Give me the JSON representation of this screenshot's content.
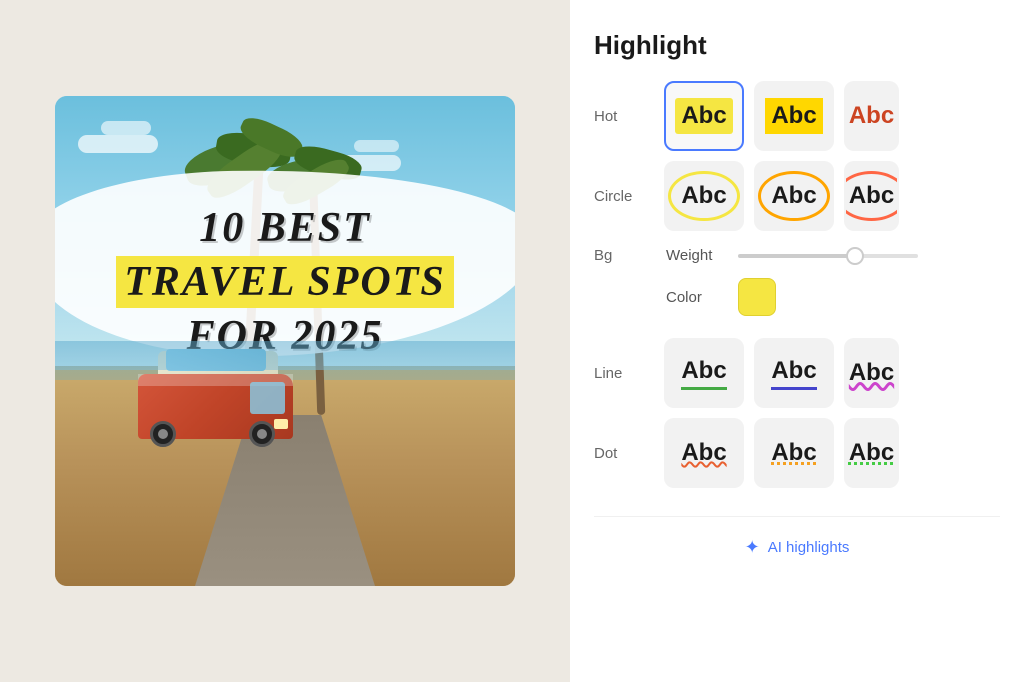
{
  "panel": {
    "title": "Highlight",
    "sidebar_labels": {
      "hot": "Hot",
      "circle": "Circle",
      "bg": "Bg",
      "line": "Line",
      "dot": "Dot"
    },
    "controls": {
      "weight_label": "Weight",
      "color_label": "Color"
    },
    "ai_button_label": "AI highlights",
    "hot_options": [
      {
        "label": "Abc",
        "style": "hot-1",
        "selected": true
      },
      {
        "label": "Abc",
        "style": "hot-2",
        "selected": false
      },
      {
        "label": "Abc",
        "style": "hot-3",
        "selected": false
      }
    ],
    "circle_options": [
      {
        "label": "Abc",
        "style": "circle-1",
        "selected": false
      },
      {
        "label": "Abc",
        "style": "circle-2",
        "selected": false
      },
      {
        "label": "Abc",
        "style": "circle-3",
        "selected": false
      }
    ],
    "line_options": [
      {
        "label": "Abc",
        "style": "line-1"
      },
      {
        "label": "Abc",
        "style": "line-2"
      },
      {
        "label": "Abc",
        "style": "line-3"
      }
    ],
    "dot_options": [
      {
        "label": "Abc",
        "style": "dot-1"
      },
      {
        "label": "Abc",
        "style": "dot-2"
      },
      {
        "label": "Abc",
        "style": "dot-3"
      }
    ]
  },
  "canvas": {
    "title_line1": "10 Best",
    "title_line2": "Travel Spots",
    "title_line3": "for 2025"
  }
}
